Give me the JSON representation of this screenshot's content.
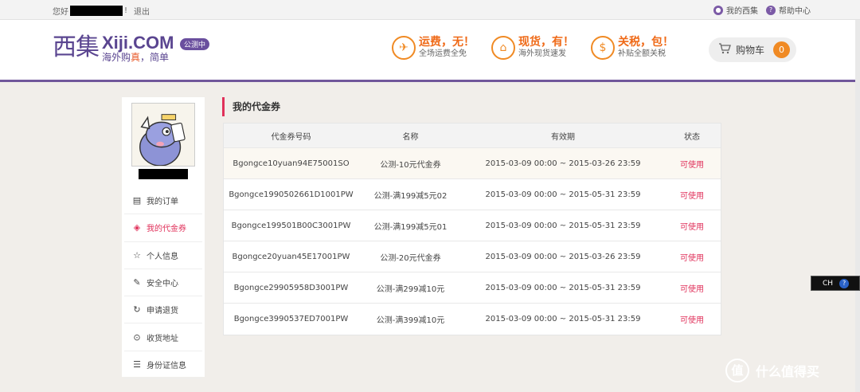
{
  "topbar": {
    "greeting": "您好",
    "exclaim": "!",
    "logout": "退出",
    "links": [
      {
        "icon": "user-icon",
        "glyph": "●",
        "label": "我的西集"
      },
      {
        "icon": "help-icon",
        "glyph": "?",
        "label": "帮助中心"
      }
    ]
  },
  "header": {
    "logo_cn": "西集",
    "logo_en": "Xiji.COM",
    "beta": "公测中",
    "tagline_a": "海外购",
    "tagline_b": "真",
    "tagline_c": "，简单",
    "promos": [
      {
        "icon": "plane-icon",
        "glyph": "✈",
        "title": "运费，无！",
        "sub": "全场运费全免"
      },
      {
        "icon": "gift-icon",
        "glyph": "⌂",
        "title": "现货，有！",
        "sub": "海外现货速发"
      },
      {
        "icon": "money-bag-icon",
        "glyph": "$",
        "title": "关税，包！",
        "sub": "补贴全额关税"
      }
    ],
    "cart": {
      "label": "购物车",
      "count": "0"
    }
  },
  "sidebar": {
    "menu": [
      {
        "icon": "order-icon",
        "glyph": "▤",
        "label": "我的订单"
      },
      {
        "icon": "coupon-tag-icon",
        "glyph": "◈",
        "label": "我的代金券",
        "active": true
      },
      {
        "icon": "star-icon",
        "glyph": "☆",
        "label": "个人信息"
      },
      {
        "icon": "edit-icon",
        "glyph": "✎",
        "label": "安全中心"
      },
      {
        "icon": "refresh-icon",
        "glyph": "↻",
        "label": "申请退货"
      },
      {
        "icon": "location-pin-icon",
        "glyph": "⊙",
        "label": "收货地址"
      },
      {
        "icon": "id-card-icon",
        "glyph": "☰",
        "label": "身份证信息"
      }
    ]
  },
  "main": {
    "title": "我的代金券",
    "columns": [
      "代金券号码",
      "名称",
      "有效期",
      "状态"
    ],
    "rows": [
      {
        "code": "Bgongce10yuan94E75001SO",
        "name": "公测-10元代金券",
        "validity": "2015-03-09 00:00 ~ 2015-03-26 23:59",
        "status": "可使用"
      },
      {
        "code": "Bgongce1990502661D1001PW",
        "name": "公测-满199减5元02",
        "validity": "2015-03-09 00:00 ~ 2015-05-31 23:59",
        "status": "可使用"
      },
      {
        "code": "Bgongce199501B00C3001PW",
        "name": "公测-满199减5元01",
        "validity": "2015-03-09 00:00 ~ 2015-05-31 23:59",
        "status": "可使用"
      },
      {
        "code": "Bgongce20yuan45E17001PW",
        "name": "公测-20元代金券",
        "validity": "2015-03-09 00:00 ~ 2015-03-26 23:59",
        "status": "可使用"
      },
      {
        "code": "Bgongce29905958D3001PW",
        "name": "公测-满299减10元",
        "validity": "2015-03-09 00:00 ~ 2015-05-31 23:59",
        "status": "可使用"
      },
      {
        "code": "Bgongce3990537ED7001PW",
        "name": "公测-满399减10元",
        "validity": "2015-03-09 00:00 ~ 2015-05-31 23:59",
        "status": "可使用"
      }
    ]
  },
  "ime": {
    "lang": "CH",
    "help": "?"
  },
  "watermark": {
    "glyph": "值",
    "text": "什么值得买"
  },
  "colors": {
    "brand_purple": "#71579b",
    "accent_orange": "#f08a24",
    "status_pink": "#e0305a"
  }
}
